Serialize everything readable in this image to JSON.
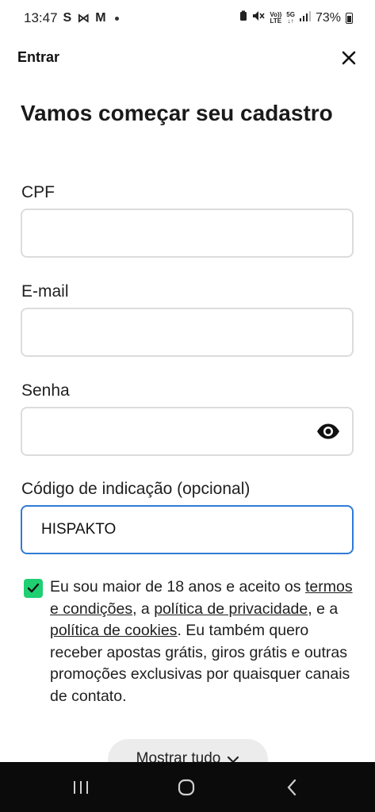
{
  "status_bar": {
    "time": "13:47",
    "left_glyphs": [
      "S",
      "⋈",
      "M"
    ],
    "battery": "73%",
    "network_top": "Vo))",
    "network_bottom": "LTE",
    "net5g_top": "5G",
    "net5g_bottom": "↓↑"
  },
  "header": {
    "title": "Entrar"
  },
  "page": {
    "title": "Vamos começar seu cadastro"
  },
  "form": {
    "cpf_label": "CPF",
    "cpf_value": "",
    "email_label": "E-mail",
    "email_value": "",
    "password_label": "Senha",
    "password_value": "",
    "referral_label": "Código de indicação (opcional)",
    "referral_value": "HISPAKTO"
  },
  "consent": {
    "checked": true,
    "text_1": "Eu sou maior de 18 anos e aceito os",
    "terms_link": "termos e condições",
    "text_2": ", a",
    "privacy_link": "política de privacidade",
    "text_3": ", e a",
    "cookies_link": "política de cookies",
    "text_4": ". Eu também quero receber apostas grátis, giros grátis e outras promoções exclusivas por quaisquer canais de contato."
  },
  "show_all": {
    "label": "Mostrar tudo"
  },
  "colors": {
    "checkbox": "#1fcf72",
    "focus_border": "#2f7bd6",
    "field_border": "#dcdcdc",
    "nav_bar": "#0b0b0b"
  }
}
